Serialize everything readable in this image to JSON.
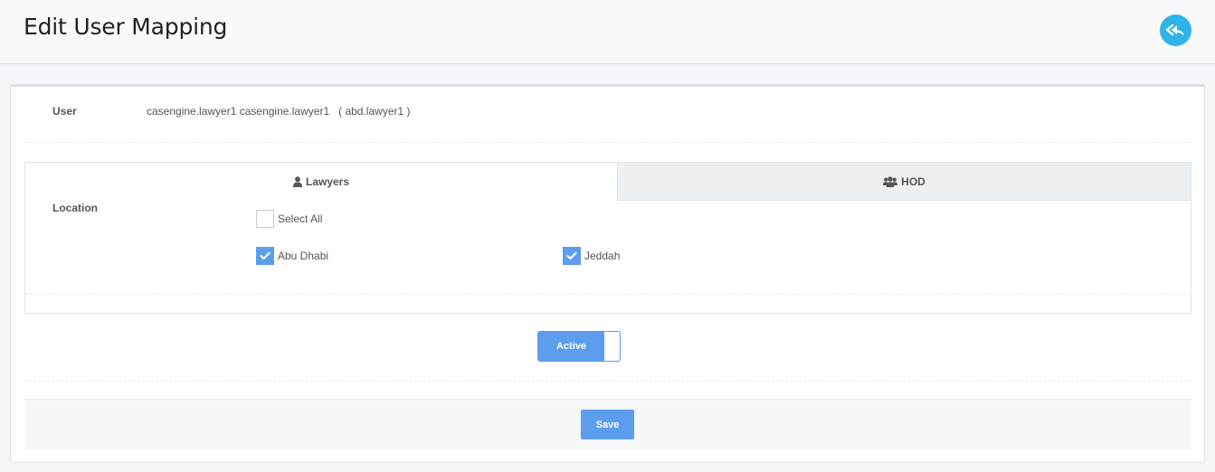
{
  "header": {
    "title": "Edit User Mapping",
    "back_icon": "reply-all-icon",
    "back_color": "#2fb4e7"
  },
  "user": {
    "label": "User",
    "value": "casengine.lawyer1 casengine.lawyer1   ( abd.lawyer1 )"
  },
  "tabs": [
    {
      "label": "Lawyers",
      "icon": "user-icon",
      "active": true
    },
    {
      "label": "HOD",
      "icon": "users-icon",
      "active": false
    }
  ],
  "location": {
    "label": "Location",
    "select_all": {
      "label": "Select All",
      "checked": false
    },
    "options": [
      {
        "label": "Abu Dhabi",
        "checked": true
      },
      {
        "label": "Jeddah",
        "checked": true
      }
    ]
  },
  "status_toggle": {
    "label": "Active",
    "on": true
  },
  "footer": {
    "save_label": "Save"
  },
  "colors": {
    "accent": "#5c9ded",
    "tab_inactive_bg": "#edf0f2"
  }
}
